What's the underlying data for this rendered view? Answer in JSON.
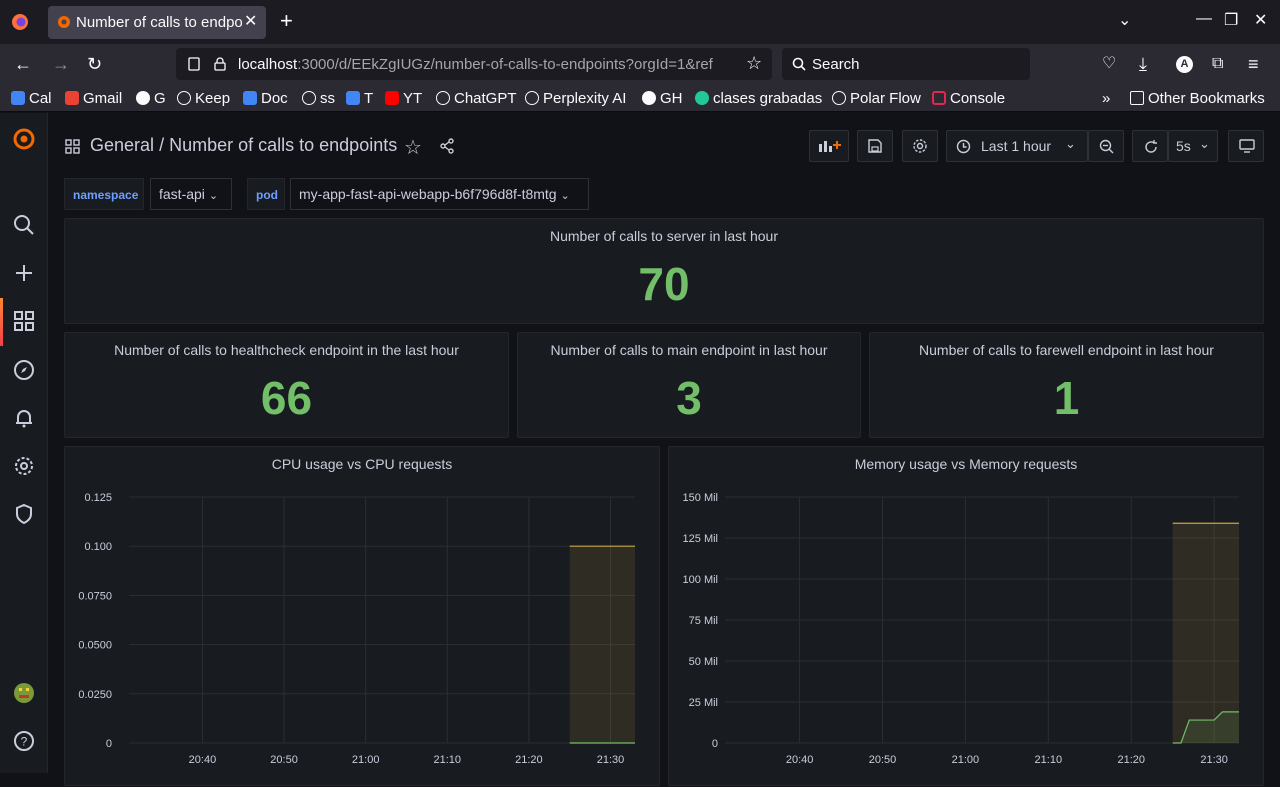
{
  "browser": {
    "tab_title": "Number of calls to endpo",
    "url_host": "localhost",
    "url_path": ":3000/d/EEkZgIUGz/number-of-calls-to-endpoints?orgId=1&ref",
    "search_placeholder": "Search",
    "bookmarks": [
      "Cal",
      "Gmail",
      "G",
      "Keep",
      "Doc",
      "ss",
      "T",
      "YT",
      "ChatGPT",
      "Perplexity AI",
      "GH",
      "clases grabadas",
      "Polar Flow",
      "Console"
    ],
    "other_bookmarks": "Other Bookmarks",
    "profile_initial": "A"
  },
  "dashboard": {
    "folder": "General",
    "separator": "/",
    "title": "Number of calls to endpoints",
    "time_range": "Last 1 hour",
    "refresh": "5s"
  },
  "variables": {
    "namespace_label": "namespace",
    "namespace_value": "fast-api",
    "pod_label": "pod",
    "pod_value": "my-app-fast-api-webapp-b6f796d8f-t8mtg"
  },
  "panels": {
    "server": {
      "title": "Number of calls to server in last hour",
      "value": "70"
    },
    "healthcheck": {
      "title": "Number of calls to healthcheck endpoint in the last hour",
      "value": "66"
    },
    "main": {
      "title": "Number of calls to main endpoint in last hour",
      "value": "3"
    },
    "farewell": {
      "title": "Number of calls to farewell endpoint in last hour",
      "value": "1"
    },
    "cpu_title": "CPU usage vs CPU requests",
    "mem_title": "Memory usage vs Memory requests"
  },
  "colors": {
    "stat_green": "#73bf69",
    "request_yellow": "#c8a53f",
    "usage_green": "#73bf69",
    "accent": "#f46800"
  },
  "chart_data": [
    {
      "type": "area",
      "title": "CPU usage vs CPU requests",
      "x": [
        "20:40",
        "20:50",
        "21:00",
        "21:10",
        "21:20",
        "21:30"
      ],
      "y_ticks": [
        "0",
        "0.0250",
        "0.0500",
        "0.0750",
        "0.100",
        "0.125"
      ],
      "ylim": [
        0,
        0.125
      ],
      "series": [
        {
          "color": "#c8a53f",
          "points": [
            [
              "21:25",
              0.1
            ],
            [
              "21:33",
              0.1
            ]
          ]
        },
        {
          "color": "#73bf69",
          "points": [
            [
              "21:25",
              0
            ],
            [
              "21:33",
              0
            ]
          ]
        }
      ]
    },
    {
      "type": "area",
      "title": "Memory usage vs Memory requests",
      "x": [
        "20:40",
        "20:50",
        "21:00",
        "21:10",
        "21:20",
        "21:30"
      ],
      "y_ticks": [
        "0",
        "25 Mil",
        "50 Mil",
        "75 Mil",
        "100 Mil",
        "125 Mil",
        "150 Mil"
      ],
      "ylim": [
        0,
        150
      ],
      "series": [
        {
          "color": "#c8a53f",
          "points": [
            [
              "21:25",
              134
            ],
            [
              "21:33",
              134
            ]
          ]
        },
        {
          "color": "#73bf69",
          "points": [
            [
              "21:25",
              0
            ],
            [
              "21:26",
              0
            ],
            [
              "21:27",
              14
            ],
            [
              "21:30",
              14
            ],
            [
              "21:31",
              19
            ],
            [
              "21:33",
              19
            ]
          ]
        }
      ]
    }
  ]
}
